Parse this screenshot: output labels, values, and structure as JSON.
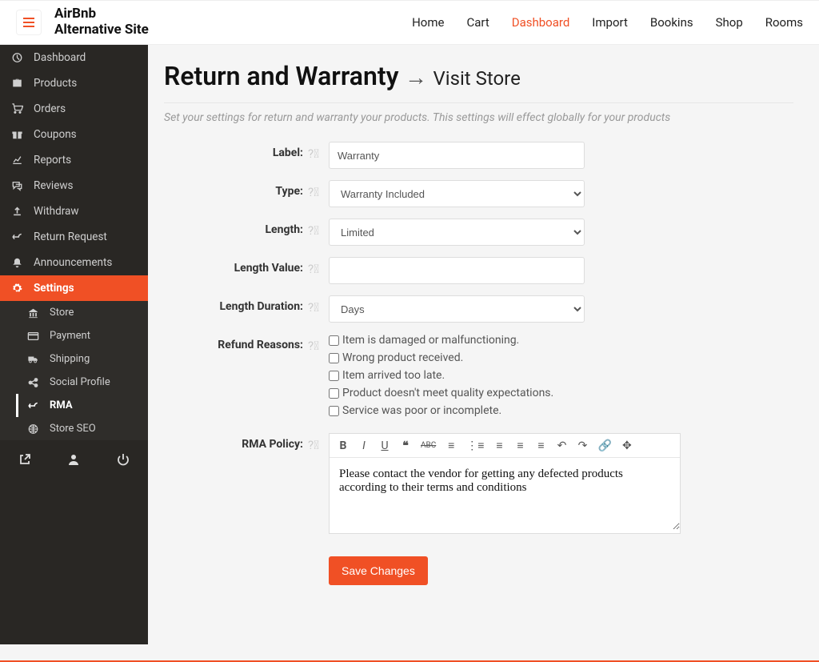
{
  "brand": {
    "line1": "AirBnb",
    "line2": "Alternative Site"
  },
  "topnav": [
    "Home",
    "Cart",
    "Dashboard",
    "Import",
    "Bookins",
    "Shop",
    "Rooms"
  ],
  "topnav_active": "Dashboard",
  "sidebar": [
    {
      "label": "Dashboard",
      "icon": "◉"
    },
    {
      "label": "Products",
      "icon": "briefcase"
    },
    {
      "label": "Orders",
      "icon": "cart"
    },
    {
      "label": "Coupons",
      "icon": "gift"
    },
    {
      "label": "Reports",
      "icon": "chart"
    },
    {
      "label": "Reviews",
      "icon": "comment"
    },
    {
      "label": "Withdraw",
      "icon": "upload"
    },
    {
      "label": "Return Request",
      "icon": "undo"
    },
    {
      "label": "Announcements",
      "icon": "bell"
    },
    {
      "label": "Settings",
      "icon": "gear",
      "active": true
    }
  ],
  "subsidebar": [
    {
      "label": "Store",
      "icon": "bank"
    },
    {
      "label": "Payment",
      "icon": "card"
    },
    {
      "label": "Shipping",
      "icon": "truck"
    },
    {
      "label": "Social Profile",
      "icon": "share"
    },
    {
      "label": "RMA",
      "icon": "undo",
      "active": true
    },
    {
      "label": "Store SEO",
      "icon": "globe"
    }
  ],
  "page": {
    "title": "Return and Warranty",
    "visit": "Visit Store",
    "desc": "Set your settings for return and warranty your products. This settings will effect globally for your products"
  },
  "form": {
    "labels": {
      "label": "Label:",
      "type": "Type:",
      "length": "Length:",
      "length_value": "Length Value:",
      "length_duration": "Length Duration:",
      "refund_reasons": "Refund Reasons:",
      "rma_policy": "RMA Policy:"
    },
    "values": {
      "label": "Warranty",
      "type": "Warranty Included",
      "length": "Limited",
      "length_value": "",
      "length_duration": "Days"
    },
    "refund_reasons": [
      "Item is damaged or malfunctioning.",
      "Wrong product received.",
      "Item arrived too late.",
      "Product doesn't meet quality expectations.",
      "Service was poor or incomplete."
    ],
    "rma_policy_text": "Please contact the vendor for getting any defected products according to their terms and conditions",
    "save_label": "Save Changes"
  }
}
